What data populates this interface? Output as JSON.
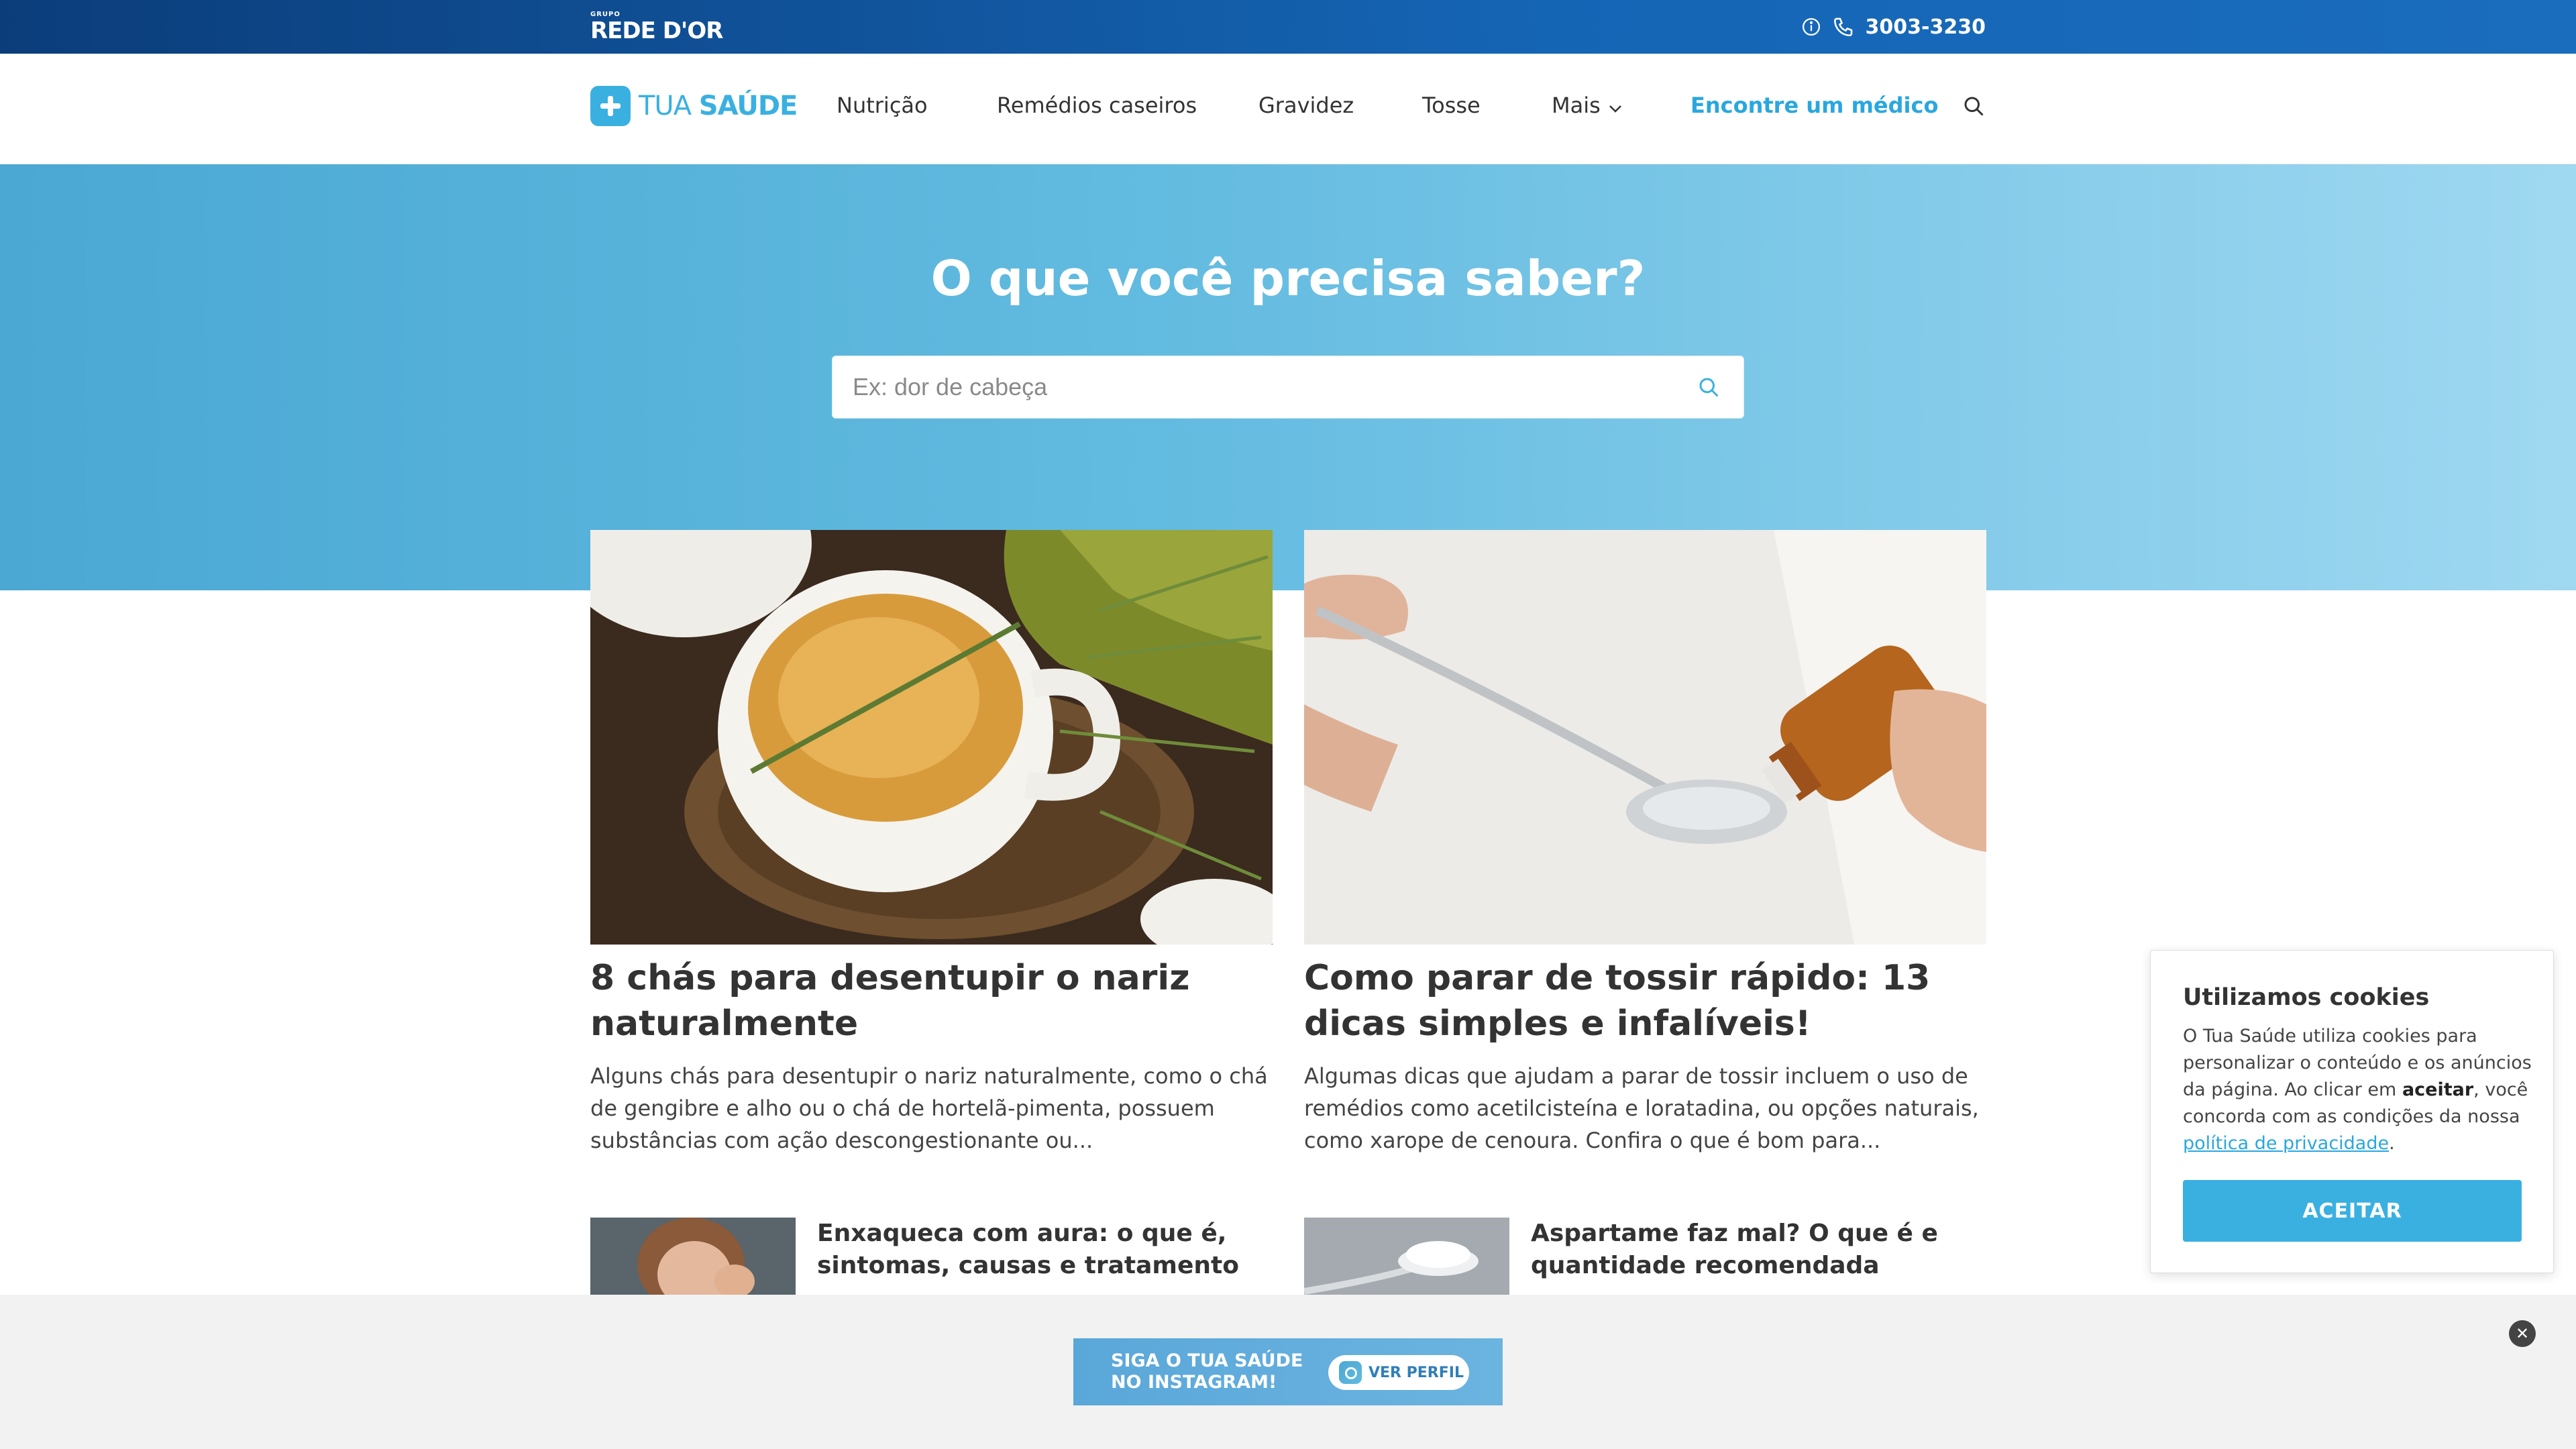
{
  "topbar": {
    "brand_grupo": "GRUPO",
    "brand_name": "REDE D'OR",
    "info_icon": "info-circle-icon",
    "phone_icon": "phone-icon",
    "phone": "3003-3230"
  },
  "nav": {
    "logo_text_light": "TUA ",
    "logo_text_bold": "SAÚDE",
    "items": [
      {
        "label": "Nutrição"
      },
      {
        "label": "Remédios caseiros"
      },
      {
        "label": "Gravidez"
      },
      {
        "label": "Tosse"
      },
      {
        "label": "Mais"
      }
    ],
    "find_doctor": "Encontre um médico",
    "search_icon": "search-icon"
  },
  "hero": {
    "title": "O que você precisa saber?",
    "search_placeholder": "Ex: dor de cabeça"
  },
  "articles": [
    {
      "title": "8 chás para desentupir o nariz naturalmente",
      "excerpt": "Alguns chás para desentupir o nariz naturalmente, como o chá de gengibre e alho ou o chá de hortelã-pimenta, possuem substâncias com ação descongestionante ou..."
    },
    {
      "title": "Como parar de tossir rápido: 13 dicas simples e infalíveis!",
      "excerpt": "Algumas dicas que ajudam a parar de tossir incluem o uso de remédios como acetilcisteína e loratadina, ou opções naturais, como xarope de cenoura. Confira o que é bom para..."
    }
  ],
  "small_articles": [
    {
      "title": "Enxaqueca com aura: o que é, sintomas, causas e tratamento"
    },
    {
      "title": "Aspartame faz mal? O que é e quantidade recomendada"
    }
  ],
  "cookie": {
    "title": "Utilizamos cookies",
    "text_1": "O Tua Saúde utiliza cookies para personalizar o conteúdo e os anúncios da página. Ao clicar em ",
    "text_bold": "aceitar",
    "text_2": ", você concorda com as condições da nossa ",
    "link": "política de privacidade",
    "text_3": ".",
    "button": "ACEITAR"
  },
  "banner": {
    "line1": "SIGA O TUA SAÚDE",
    "line2": "NO INSTAGRAM!",
    "cta": "VER PERFIL",
    "close": "✕"
  },
  "colors": {
    "accent": "#3ab0e1",
    "topbar": "#1565b5",
    "link": "#2aa7de"
  }
}
